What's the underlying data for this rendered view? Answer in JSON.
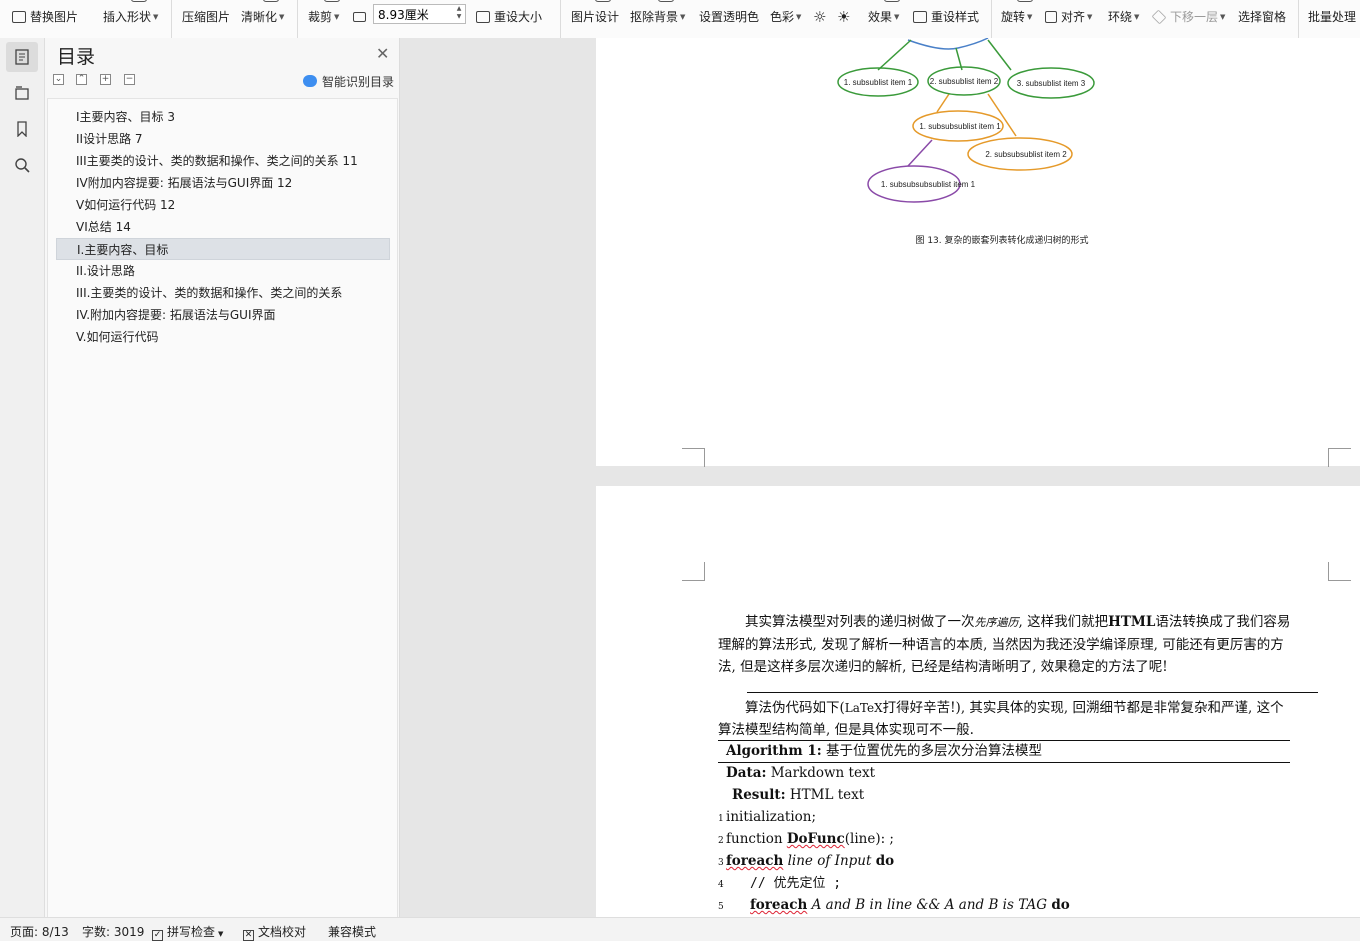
{
  "ribbon": {
    "replace_image": "替换图片",
    "insert_shape": "插入形状",
    "compress_image": "压缩图片",
    "clarify": "清晰化",
    "crop": "裁剪",
    "width_value": "8.93厘米",
    "reset_size": "重设大小",
    "image_design": "图片设计",
    "remove_bg": "抠除背景",
    "set_transparent": "设置透明色",
    "color": "色彩",
    "effects": "效果",
    "reset_style": "重设样式",
    "rotate": "旋转",
    "align": "对齐",
    "wrap": "环绕",
    "send_backward": "下移一层",
    "selection_pane": "选择窗格",
    "batch": "批量处理"
  },
  "toc": {
    "title": "目录",
    "smart": "智能识别目录",
    "items": [
      {
        "label": "I主要内容、目标  3"
      },
      {
        "label": "II设计思路  7"
      },
      {
        "label": "III主要类的设计、类的数据和操作、类之间的关系  11"
      },
      {
        "label": "IV附加内容提要: 拓展语法与GUI界面  12"
      },
      {
        "label": "V如何运行代码  12"
      },
      {
        "label": "VI总结  14"
      },
      {
        "label": "I.主要内容、目标"
      },
      {
        "label": "II.设计思路"
      },
      {
        "label": "III.主要类的设计、类的数据和操作、类之间的关系"
      },
      {
        "label": "IV.附加内容提要: 拓展语法与GUI界面"
      },
      {
        "label": "V.如何运行代码"
      }
    ]
  },
  "figure": {
    "nodes": {
      "n1": "1. subsublist item 1",
      "n2": "2. subsublist item 2",
      "n3": "3. subsublist item 3",
      "n4": "1. subsubsublist item 1",
      "n5": "2. subsubsublist item 2",
      "n6": "1. subsubsubsublist item 1"
    },
    "caption": "图 13. 复杂的嵌套列表转化成递归树的形式"
  },
  "page2": {
    "para1_a": "其实算法模型对列表的递归树做了一次",
    "para1_term": "先序遍历",
    "para1_b": ", 这样我们就把",
    "para1_bold": "HTML",
    "para1_c": "语法转换成了我们容易理解的算法形式, 发现了解析一种语言的本质, 当然因为我还没学编译原理, 可能还有更厉害的方法, 但是这样多层次递归的解析, 已经是结构清晰明了, 效果稳定的方法了呢!",
    "para2_a": "算法伪代码如下(",
    "para2_latex": "LaTeX",
    "para2_b": "打得好辛苦!), 其实具体的实现, 回溯细节都是非常复杂和严谨, 这个算法模型结构简单, 但是具体实现可不一般.",
    "algo_label": "Algorithm 1:",
    "algo_title": "基于位置优先的多层次分治算法模型",
    "data_label": "Data:",
    "data_val": "Markdown text",
    "result_label": "Result:",
    "result_val": "HTML text",
    "lines": [
      {
        "no": "1",
        "text": "initialization;"
      },
      {
        "no": "2",
        "pre": "function ",
        "func": "DoFunc",
        "post": "(line): ;"
      },
      {
        "no": "3",
        "kw": "foreach",
        "mid": " line of Input ",
        "kw2": "do"
      },
      {
        "no": "4",
        "text": "// 优先定位 ;"
      },
      {
        "no": "5",
        "kw": "foreach",
        "mid": " A and B in line && A and B is TAG ",
        "kw2": "do"
      }
    ]
  },
  "status": {
    "page": "页面: 8/13",
    "words": "字数: 3019",
    "spell": "拼写检查",
    "proof": "文档校对",
    "compat": "兼容模式"
  }
}
